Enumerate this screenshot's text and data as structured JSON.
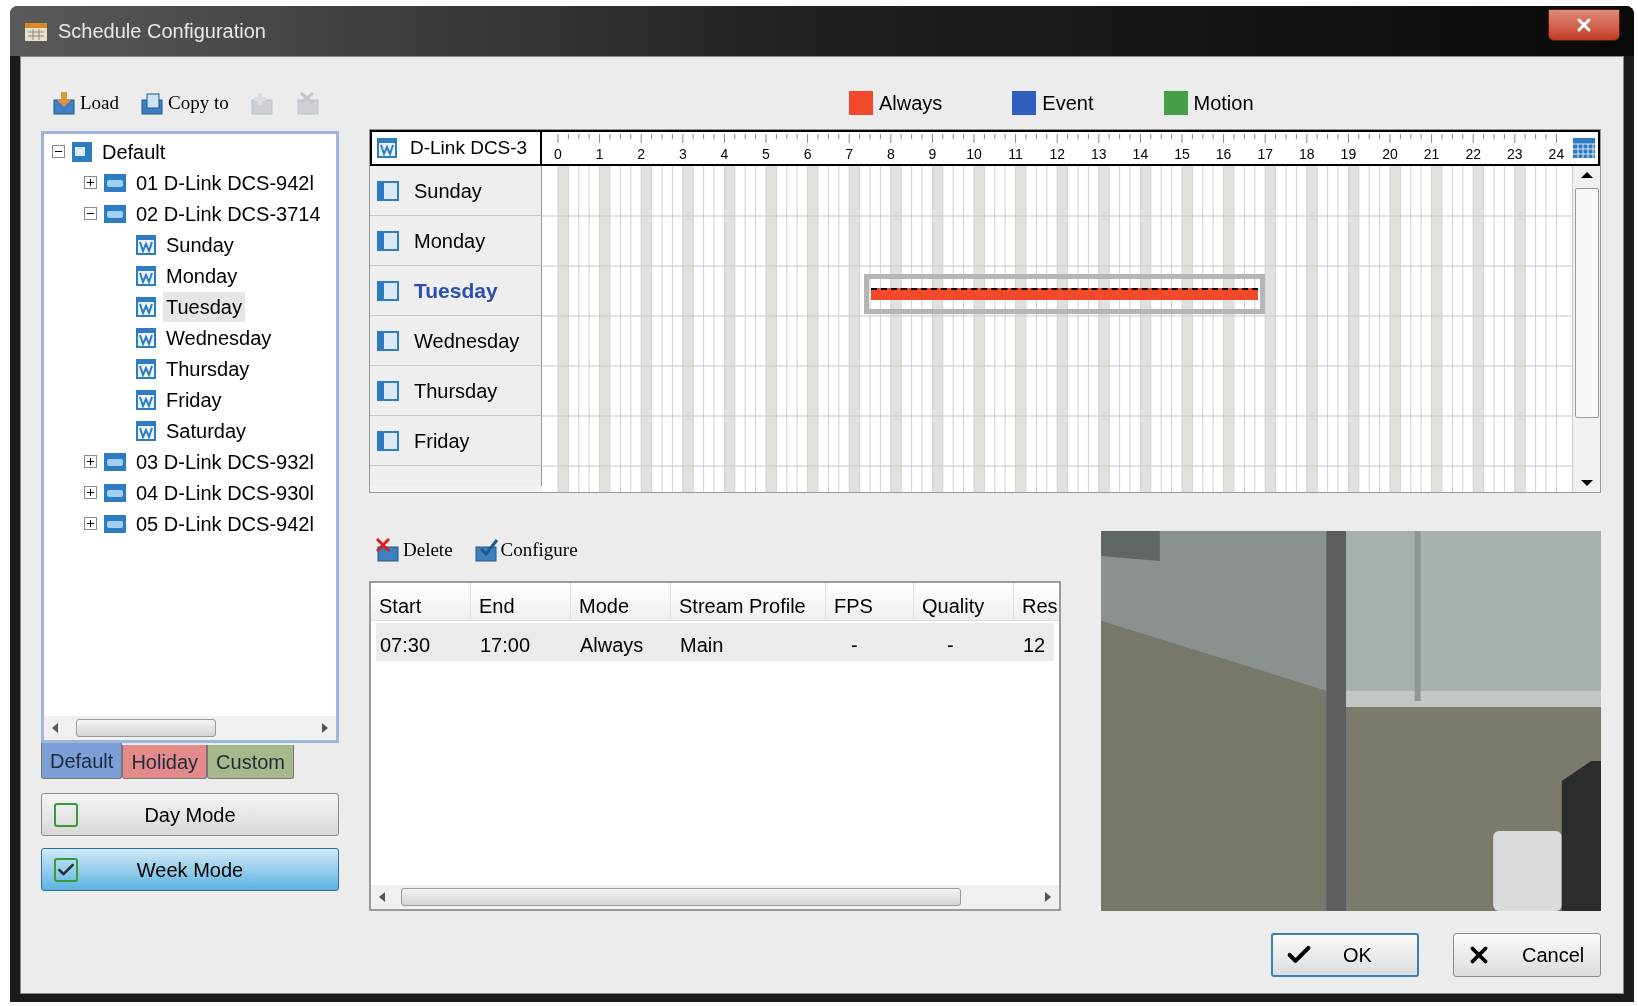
{
  "window": {
    "title": "Schedule Configuration"
  },
  "toolbar": [
    {
      "label": "Load",
      "kind": "load",
      "disabled": false
    },
    {
      "label": "Copy to",
      "kind": "copy",
      "disabled": false
    },
    {
      "kind": "add",
      "disabled": true
    },
    {
      "kind": "remove",
      "disabled": true
    }
  ],
  "tree": [
    {
      "label": "Default",
      "kind": "root",
      "expanded": true,
      "children": [
        {
          "label": "01 D-Link DCS-942l",
          "kind": "camera",
          "expanded": false
        },
        {
          "label": "02 D-Link DCS-3714",
          "kind": "camera",
          "expanded": true,
          "children": [
            {
              "label": "Sunday",
              "kind": "day",
              "selected": false
            },
            {
              "label": "Monday",
              "kind": "day",
              "selected": false
            },
            {
              "label": "Tuesday",
              "kind": "day",
              "selected": true
            },
            {
              "label": "Wednesday",
              "kind": "day",
              "selected": false
            },
            {
              "label": "Thursday",
              "kind": "day",
              "selected": false
            },
            {
              "label": "Friday",
              "kind": "day",
              "selected": false
            },
            {
              "label": "Saturday",
              "kind": "day",
              "selected": false
            }
          ]
        },
        {
          "label": "03 D-Link DCS-932l",
          "kind": "camera",
          "expanded": false
        },
        {
          "label": "04 D-Link DCS-930l",
          "kind": "camera",
          "expanded": false
        },
        {
          "label": "05 D-Link DCS-942l",
          "kind": "camera",
          "expanded": false
        }
      ]
    }
  ],
  "schedule_tabs": [
    {
      "label": "Default",
      "color": "#7b9fd6",
      "selected": true
    },
    {
      "label": "Holiday",
      "color": "#e38a8a",
      "selected": false
    },
    {
      "label": "Custom",
      "color": "#a7b98c",
      "selected": false
    }
  ],
  "modes": [
    {
      "label": "Day Mode",
      "checked": false
    },
    {
      "label": "Week Mode",
      "checked": true
    }
  ],
  "legend": [
    {
      "label": "Always",
      "kind": "always",
      "color": "#f04a2a"
    },
    {
      "label": "Event",
      "kind": "event",
      "color": "#2f5fbf"
    },
    {
      "label": "Motion",
      "kind": "motion",
      "color": "#43a047"
    }
  ],
  "timeline": {
    "camera": "D-Link DCS-3",
    "hours": [
      "0",
      "1",
      "2",
      "3",
      "4",
      "5",
      "6",
      "7",
      "8",
      "9",
      "10",
      "11",
      "12",
      "13",
      "14",
      "15",
      "16",
      "17",
      "18",
      "19",
      "20",
      "21",
      "22",
      "23",
      "24"
    ],
    "days": [
      {
        "label": "Sunday",
        "selected": false
      },
      {
        "label": "Monday",
        "selected": false
      },
      {
        "label": "Tuesday",
        "selected": true
      },
      {
        "label": "Wednesday",
        "selected": false
      },
      {
        "label": "Thursday",
        "selected": false
      },
      {
        "label": "Friday",
        "selected": false
      }
    ]
  },
  "actions": [
    {
      "label": "Delete",
      "kind": "delete"
    },
    {
      "label": "Configure",
      "kind": "configure"
    }
  ],
  "table": {
    "columns": [
      "Start",
      "End",
      "Mode",
      "Stream Profile",
      "FPS",
      "Quality",
      "Res"
    ],
    "rows": [
      {
        "kind": "always",
        "selected": true,
        "cells": [
          "07:30",
          "17:00",
          "Always",
          "Main",
          "-",
          "-",
          "12"
        ]
      }
    ]
  },
  "buttons": [
    {
      "label": "OK",
      "kind": "ok",
      "default": true
    },
    {
      "label": "Cancel",
      "kind": "cancel",
      "default": false
    }
  ]
}
